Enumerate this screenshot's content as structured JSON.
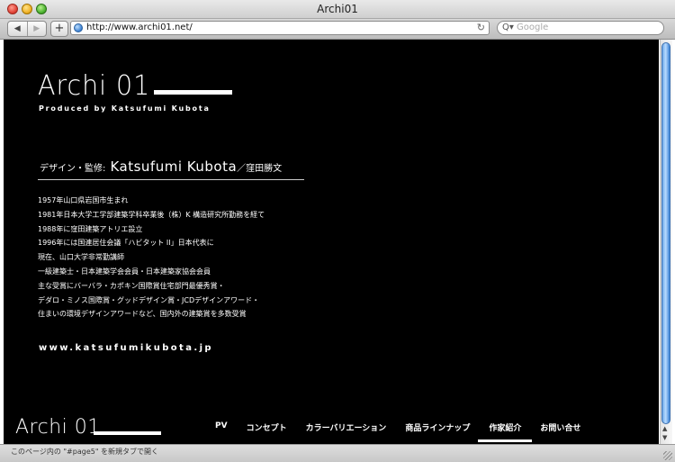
{
  "window": {
    "title": "Archi01"
  },
  "toolbar": {
    "back_icon": "back-arrow-icon",
    "back_glyph": "◀",
    "forward_glyph": "▶",
    "add_glyph": "+",
    "url": "http://www.archi01.net/",
    "reload_glyph": "↻",
    "search_icon_glyph": "Q▾",
    "search_placeholder": "Google"
  },
  "page": {
    "logo": "Archi 01",
    "produced_by": "Produced by Katsufumi Kubota",
    "designer": {
      "label": "デザイン・監修:",
      "name": "Katsufumi Kubota",
      "japanese_name": "／窪田勝文"
    },
    "bio": [
      "1957年山口県岩国市生まれ",
      "1981年日本大学工学部建築学科卒業後（株）K 構造研究所勤務を経て",
      "1988年に窪田建築アトリエ設立",
      "1996年には国連居住会議「ハビタット II」日本代表に",
      "現在、山口大学非常勤講師",
      "一級建築士・日本建築学会会員・日本建築家協会会員",
      "主な受賞にバーバラ・カポキン国際賞住宅部門最優秀賞・",
      "デダロ・ミノス国際賞・グッドデザイン賞・JCDデザインアワード・",
      "住まいの環境デザインアワードなど、国内外の建築賞を多数受賞"
    ],
    "website": "www.katsufumikubota.jp",
    "footer_logo": "Archi 01",
    "nav": [
      {
        "label": "PV",
        "active": false
      },
      {
        "label": "コンセプト",
        "active": false
      },
      {
        "label": "カラーバリエーション",
        "active": false
      },
      {
        "label": "商品ラインナップ",
        "active": false
      },
      {
        "label": "作家紹介",
        "active": true
      },
      {
        "label": "お問い合せ",
        "active": false
      }
    ]
  },
  "status": {
    "text": "このページ内の \"#page5\" を新規タブで開く"
  }
}
